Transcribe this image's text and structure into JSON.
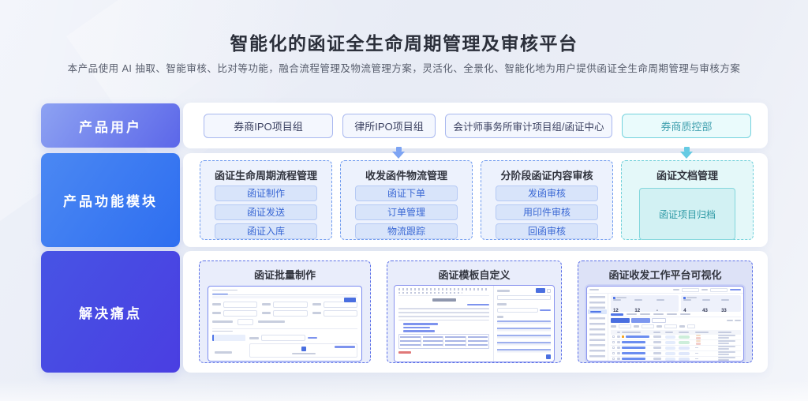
{
  "header": {
    "title": "智能化的函证全生命周期管理及审核平台",
    "subtitle": "本产品使用 AI 抽取、智能审核、比对等功能，融合流程管理及物流管理方案，灵活化、全景化、智能化地为用户提供函证全生命周期管理与审核方案"
  },
  "rows": [
    {
      "id": "users",
      "label": "产品用户",
      "buttons": [
        {
          "label": "券商IPO项目组",
          "variant": "blue"
        },
        {
          "label": "律所IPO项目组",
          "variant": "blue"
        },
        {
          "label": "会计师事务所审计项目组/函证中心",
          "variant": "blue"
        },
        {
          "label": "券商质控部",
          "variant": "teal"
        }
      ]
    },
    {
      "id": "modules",
      "label": "产品功能模块",
      "groups": [
        {
          "title": "函证生命周期流程管理",
          "items": [
            "函证制作",
            "函证发送",
            "函证入库"
          ],
          "variant": "blue"
        },
        {
          "title": "收发函件物流管理",
          "items": [
            "函证下单",
            "订单管理",
            "物流跟踪"
          ],
          "variant": "blue"
        },
        {
          "title": "分阶段函证内容审核",
          "items": [
            "发函审核",
            "用印件审核",
            "回函审核"
          ],
          "variant": "blue"
        },
        {
          "title": "函证文档管理",
          "archive_label": "函证项目归档",
          "variant": "teal"
        }
      ]
    },
    {
      "id": "painpoints",
      "label": "解决痛点",
      "cards": [
        {
          "title": "函证批量制作"
        },
        {
          "title": "函证模板自定义"
        },
        {
          "title": "函证收发工作平台可视化",
          "dashboard_stats": {
            "left": [
              "12",
              "12",
              "-"
            ],
            "right": [
              "4",
              "43",
              "33"
            ]
          }
        }
      ]
    }
  ],
  "colors": {
    "primary_blue": "#2f6ef0",
    "periwinkle": "#5c67e9",
    "indigo": "#4a3ee2",
    "teal": "#5fc9e2",
    "chip_text": "#3a4060",
    "module_chip_text": "#3a68d4",
    "archive_text": "#2f9aa6"
  }
}
